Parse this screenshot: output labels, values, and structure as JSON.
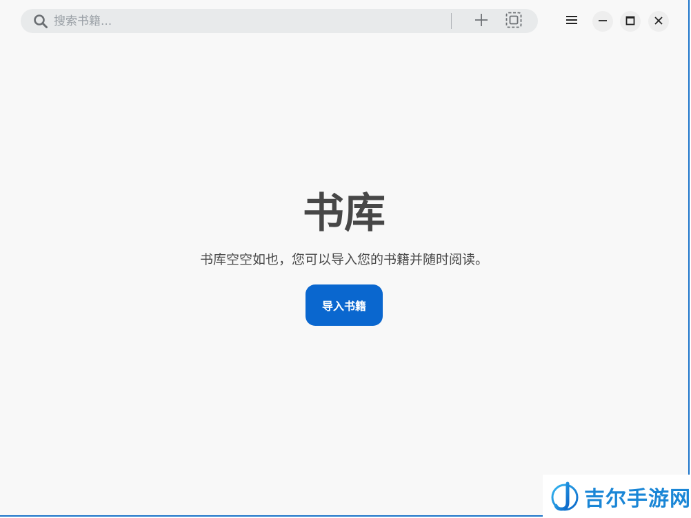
{
  "toolbar": {
    "search": {
      "placeholder": "搜索书籍...",
      "value": ""
    },
    "icons": {
      "search": "search-icon",
      "add": "plus-icon",
      "scan": "select-all-icon",
      "menu": "hamburger-menu-icon",
      "minimize": "minimize-icon",
      "maximize": "maximize-icon",
      "close": "close-icon"
    }
  },
  "library": {
    "title": "书库",
    "empty_message": "书库空空如也，您可以导入您的书籍并随时阅读。",
    "import_button_label": "导入书籍"
  },
  "watermark": {
    "text": "吉尔手游网"
  },
  "colors": {
    "accent": "#0a67cf",
    "background": "#f8f8f8",
    "search_bg": "#e8eaeb",
    "title_text": "#474747",
    "watermark": "#1a86d6"
  }
}
